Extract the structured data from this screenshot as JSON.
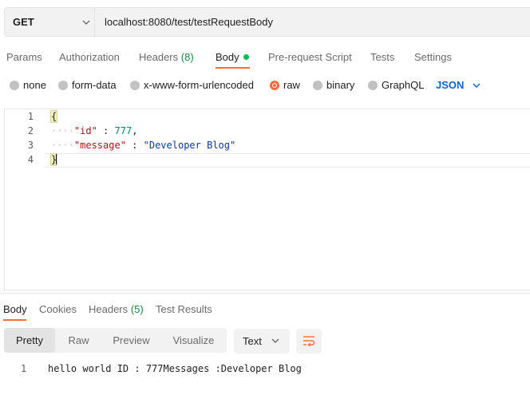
{
  "request": {
    "method": "GET",
    "url": "localhost:8080/test/testRequestBody"
  },
  "request_tabs": {
    "params": "Params",
    "authorization": "Authorization",
    "headers": "Headers",
    "headers_count": "(8)",
    "body": "Body",
    "pre_request": "Pre-request Script",
    "tests": "Tests",
    "settings": "Settings"
  },
  "body_types": {
    "none": "none",
    "form_data": "form-data",
    "urlencoded": "x-www-form-urlencoded",
    "raw": "raw",
    "binary": "binary",
    "graphql": "GraphQL",
    "selected": "raw",
    "format": "JSON"
  },
  "editor": {
    "line_numbers": [
      "1",
      "2",
      "3",
      "4"
    ],
    "open_brace": "{",
    "close_brace": "}",
    "indent": "····",
    "key1": "\"id\"",
    "sep1": " : ",
    "val1": "777",
    "comma": ",",
    "key2": "\"message\"",
    "sep2": " : ",
    "val2": "\"Developer Blog\""
  },
  "response_tabs": {
    "body": "Body",
    "cookies": "Cookies",
    "headers": "Headers",
    "headers_count": "(5)",
    "test_results": "Test Results"
  },
  "response_view": {
    "pretty": "Pretty",
    "raw": "Raw",
    "preview": "Preview",
    "visualize": "Visualize",
    "format": "Text"
  },
  "response_body": {
    "line_number": "1",
    "text": "hello world ID : 777Messages :Developer Blog"
  },
  "colors": {
    "accent": "#ff6c37",
    "json_link": "#0265d2",
    "count_green": "#0f8a3f"
  }
}
